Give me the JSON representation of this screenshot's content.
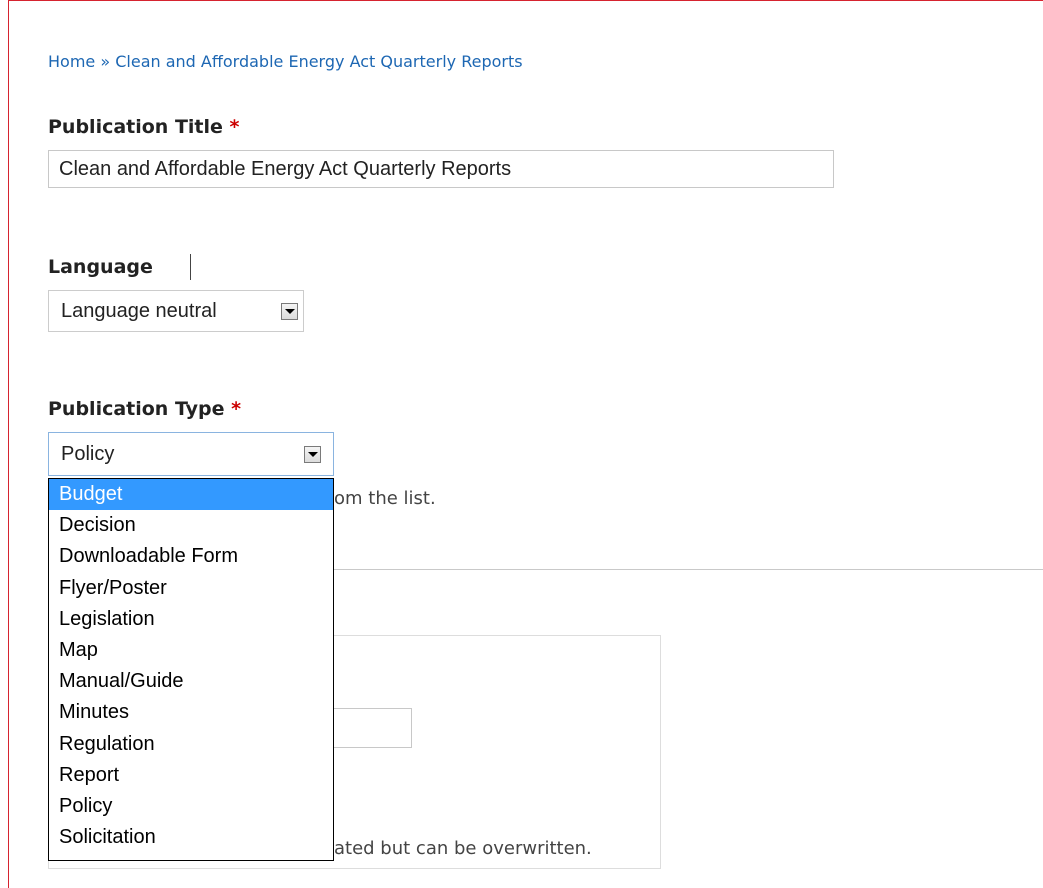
{
  "breadcrumb": {
    "home": "Home",
    "separator": "»",
    "current": "Clean and Affordable Energy Act Quarterly Reports"
  },
  "publication_title": {
    "label": "Publication Title",
    "required_mark": "*",
    "value": "Clean and Affordable Energy Act Quarterly Reports"
  },
  "language": {
    "label": "Language",
    "selected": "Language neutral"
  },
  "publication_type": {
    "label": "Publication Type",
    "required_mark": "*",
    "selected": "Policy",
    "help_text_visible": "om the list.",
    "highlighted_option": "Budget",
    "options": [
      "Budget",
      "Decision",
      "Downloadable Form",
      "Flyer/Poster",
      "Legislation",
      "Map",
      "Manual/Guide",
      "Minutes",
      "Regulation",
      "Report",
      "Policy",
      "Solicitation"
    ]
  },
  "lower_fieldset": {
    "help_text_visible": "ated but can be overwritten."
  },
  "colors": {
    "frame_border": "#d6232f",
    "link": "#1d67b3",
    "required": "#cc0000",
    "highlight": "#3399ff"
  }
}
